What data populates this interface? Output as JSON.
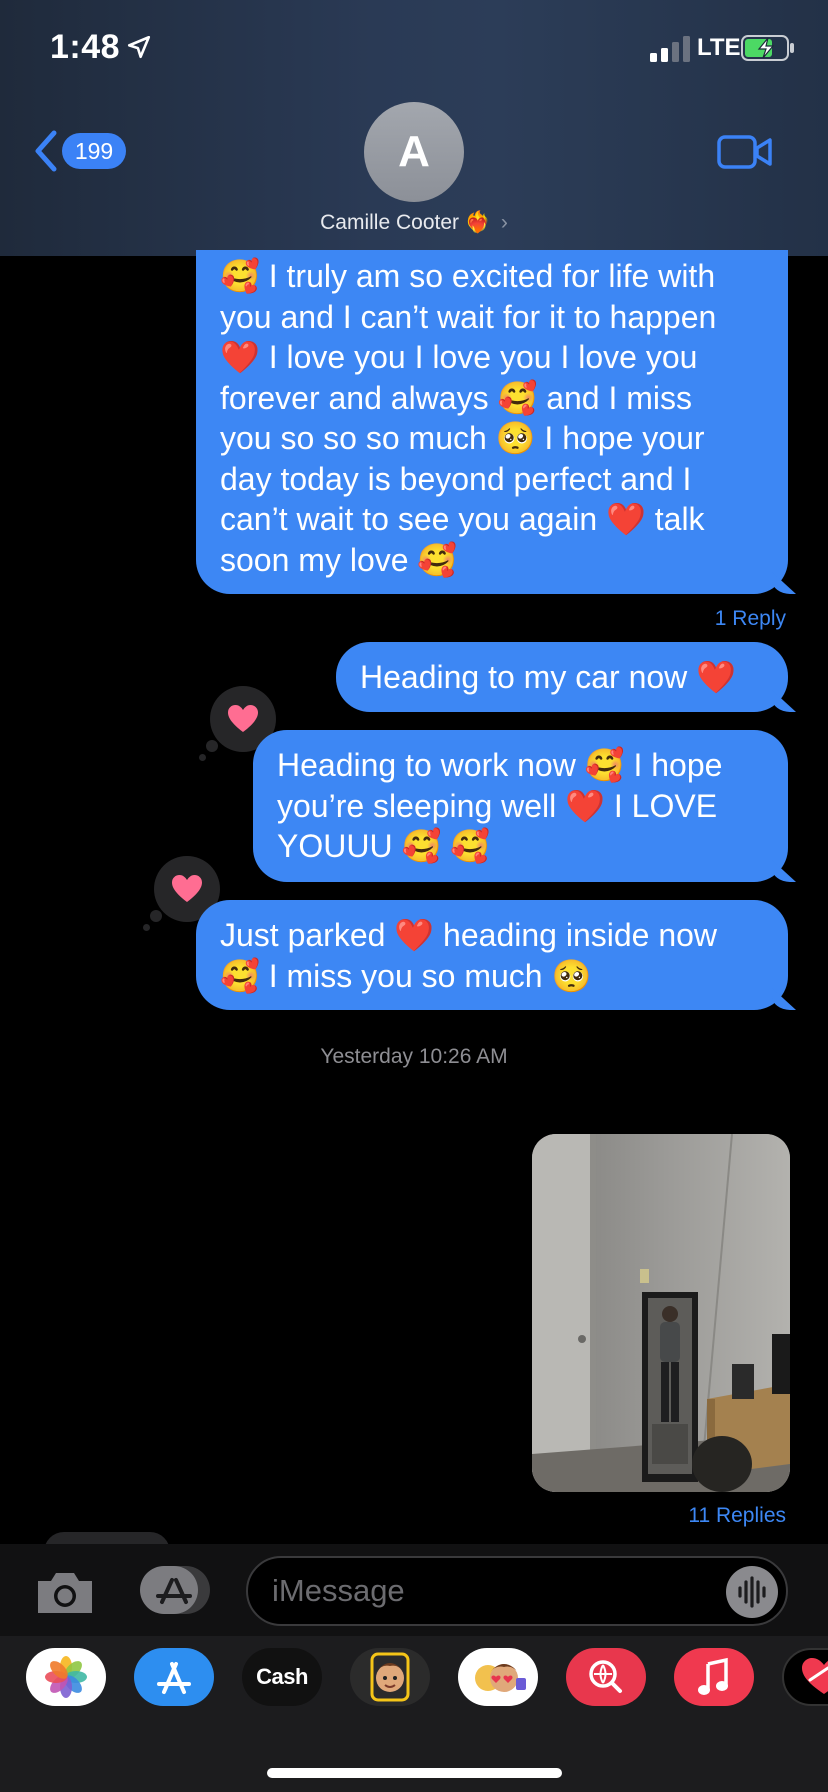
{
  "status_bar": {
    "time": "1:48",
    "network": "LTE",
    "battery_charging": true
  },
  "header": {
    "back_count": "199",
    "avatar_initial": "A",
    "contact_name": "Camille Cooter",
    "contact_emoji": "❤️‍🔥",
    "chevron": "›"
  },
  "messages": [
    {
      "sender": "me",
      "lines": [
        "🥰 I truly am so excited for life with",
        "you and I can’t wait for it to happen",
        "❤️ I love you I love you I love you",
        "forever and always 🥰 and I miss",
        "you so so so much 🥺 I hope your",
        "day today is beyond perfect and I",
        "can’t wait to see you again ❤️ talk",
        "soon my love 🥰"
      ],
      "reply_label": "1 Reply"
    },
    {
      "sender": "me",
      "lines": [
        "Heading to my car now ❤️"
      ]
    },
    {
      "sender": "me",
      "lines": [
        "Heading to work now 🥰 I hope",
        "you’re sleeping well ❤️ I LOVE",
        "YOUUU 🥰 🥰"
      ],
      "tapback": "heart"
    },
    {
      "sender": "me",
      "lines": [
        "Just parked ❤️ heading inside now",
        "🥰 I miss you so much 🥺"
      ],
      "tapback": "heart"
    }
  ],
  "timestamp": {
    "day": "Yesterday",
    "time": "10:26 AM"
  },
  "photo_message": {
    "reply_label": "11 Replies"
  },
  "input": {
    "placeholder": "iMessage"
  },
  "app_drawer": [
    {
      "name": "photos-icon"
    },
    {
      "name": "app-store-icon"
    },
    {
      "name": "apple-cash-icon",
      "label": "Cash"
    },
    {
      "name": "memoji-icon"
    },
    {
      "name": "memoji-stickers-icon"
    },
    {
      "name": "images-search-icon"
    },
    {
      "name": "music-icon"
    },
    {
      "name": "digital-touch-icon"
    }
  ],
  "colors": {
    "bubble_blue": "#3d87f4",
    "link_blue": "#3d87f4",
    "tapback_heart": "#ff6d92",
    "header_bg": "#2a3a55"
  }
}
